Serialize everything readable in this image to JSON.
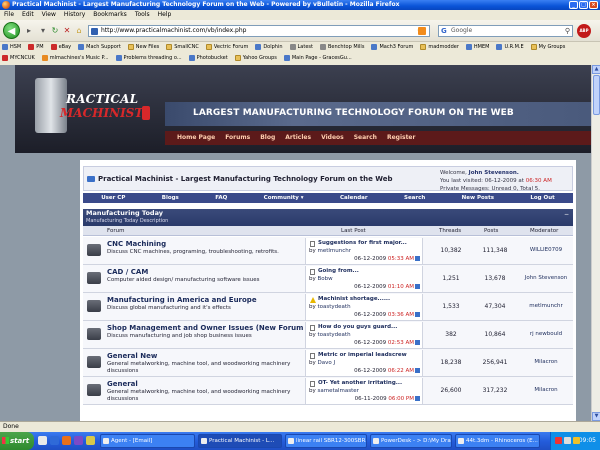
{
  "window": {
    "title": "Practical Machinist - Largest Manufacturing Technology Forum on the Web - Powered by vBulletin - Mozilla Firefox"
  },
  "menu": [
    "File",
    "Edit",
    "View",
    "History",
    "Bookmarks",
    "Tools",
    "Help"
  ],
  "navbar": {
    "url": "http://www.practicalmachinist.com/vb/index.php",
    "search_placeholder": "Google"
  },
  "bookmarks_row1": [
    "HSM",
    "PM",
    "eBay",
    "Mach Support",
    "New Files",
    "SmallCNC",
    "Vectric Forum",
    "Dolphin",
    "Latest",
    "Benchtop Mills",
    "Mach3 Forum",
    "madmodder",
    "HMEM",
    "U.R.M.E",
    "My Groups"
  ],
  "bookmarks_row2": [
    "MYCNCUK",
    "mlmachines's Music P...",
    "Problems threading o...",
    "Photobucket",
    "Yahoo Groups",
    "Main Page - GracesGu..."
  ],
  "site": {
    "logo_line1": "RACTICAL",
    "logo_line2": "MACHINIST",
    "banner": "LARGEST MANUFACTURING TECHNOLOGY FORUM ON THE WEB",
    "nav": [
      "Home Page",
      "Forums",
      "Blog",
      "Articles",
      "Videos",
      "Search",
      "Register"
    ]
  },
  "forum": {
    "title": "Practical Machinist - Largest Manufacturing Technology Forum on the Web",
    "welcome_label": "Welcome,",
    "welcome_name": "John Stevenson.",
    "last_visited_label": "You last visited: 06-12-2009 at",
    "last_visited_time": "06:30 AM",
    "private_messages": "Private Messages: Unread 0, Total 5.",
    "userbar": [
      "User CP",
      "Blogs",
      "FAQ",
      "Community ▾",
      "Calendar",
      "Search",
      "New Posts",
      "Log Out"
    ],
    "category_title": "Manufacturing Today",
    "category_desc": "Manufacturing Today Description",
    "columns": {
      "forum": "Forum",
      "last_post": "Last Post",
      "threads": "Threads",
      "posts": "Posts",
      "moderator": "Moderator"
    },
    "rows": [
      {
        "name": "CNC Machining",
        "desc": "Discuss CNC machines, programing, troubleshooting, retrofits.",
        "lp_title": "Suggestions for first major...",
        "lp_by": "metlmunchr",
        "lp_date": "06-12-2009",
        "lp_time": "05:33 AM",
        "threads": "10,382",
        "posts": "111,348",
        "mod": "WILLIE0709",
        "warn": false
      },
      {
        "name": "CAD / CAM",
        "desc": "Computer aided design/ manufacturing software issues",
        "lp_title": "Going from...",
        "lp_by": "Bobw",
        "lp_date": "06-12-2009",
        "lp_time": "01:10 AM",
        "threads": "1,251",
        "posts": "13,678",
        "mod": "John Stevenson",
        "warn": false
      },
      {
        "name": "Manufacturing in America and Europe",
        "desc": "Discuss global manufacturing and it's effects",
        "lp_title": "Machinist shortage......",
        "lp_by": "toastydeath",
        "lp_date": "06-12-2009",
        "lp_time": "03:36 AM",
        "threads": "1,533",
        "posts": "47,304",
        "mod": "metlmunchr",
        "warn": true
      },
      {
        "name": "Shop Management and Owner Issues (New Forum !)",
        "desc": "Discuss manufacturing and job shop business issues",
        "lp_title": "How do you guys guard...",
        "lp_by": "toastydeath",
        "lp_date": "06-12-2009",
        "lp_time": "02:53 AM",
        "threads": "382",
        "posts": "10,864",
        "mod": "rj newbould",
        "warn": false
      },
      {
        "name": "General New",
        "desc": "General metalworking, machine tool, and woodworking machinery discussions",
        "lp_title": "Metric or imperial leadscrew",
        "lp_by": "Davo J",
        "lp_date": "06-12-2009",
        "lp_time": "06:22 AM",
        "threads": "18,238",
        "posts": "256,941",
        "mod": "Milacron",
        "warn": false
      },
      {
        "name": "General",
        "desc": "General metalworking, machine tool, and woodworking machinery discussions",
        "lp_title": "OT- Yet another irritating...",
        "lp_by": "sametalmaster",
        "lp_date": "06-11-2009",
        "lp_time": "06:00 PM",
        "threads": "26,600",
        "posts": "317,232",
        "mod": "Milacron",
        "warn": false
      }
    ]
  },
  "status_text": "Done",
  "taskbar": {
    "start": "start",
    "tasks": [
      "Agent - [Email]",
      "Practical Machinist - L...",
      "linear rail SBR12-300SBR...",
      "PowerDesk - > D:\\My Dra...",
      "44t.3dm - Rhinoceros (E..."
    ],
    "clock": "09:05"
  }
}
